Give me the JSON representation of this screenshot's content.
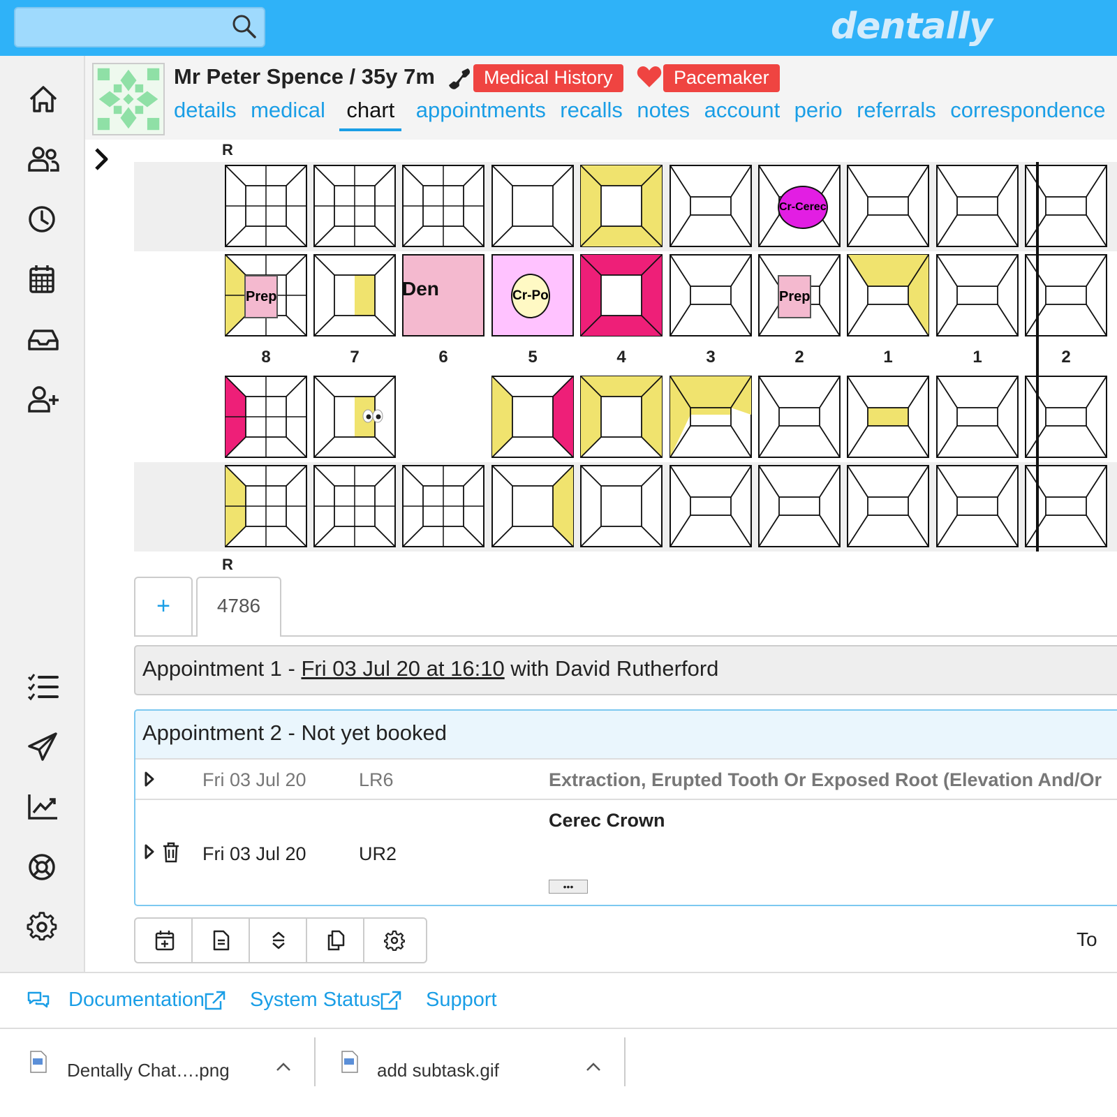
{
  "brand": "dentally",
  "search": {
    "placeholder": ""
  },
  "patient": {
    "name": "Mr Peter Spence / 35y 7m",
    "badge_medical": "Medical History",
    "badge_alert": "Pacemaker"
  },
  "tabs": [
    "details",
    "medical",
    "chart",
    "appointments",
    "recalls",
    "notes",
    "account",
    "perio",
    "referrals",
    "correspondence"
  ],
  "active_tab": "chart",
  "chart": {
    "quadrant_label_top": "R",
    "quadrant_label_bottom": "R",
    "tooth_numbers": [
      "8",
      "7",
      "6",
      "5",
      "4",
      "3",
      "2",
      "1",
      "1",
      "2"
    ],
    "annotations": {
      "upper_2_buccal": "Cr-Cerec",
      "upper_8_occlusal": "Prep",
      "upper_6": "Den",
      "upper_5": "Cr-Po",
      "upper_2_occlusal": "Prep"
    },
    "colors": {
      "filling": "#f0e36e",
      "extraction": "#ee1f78",
      "prep": "#f4b9cf",
      "crown_cerec": "#e21ee3",
      "crown_po": "#fff9c4",
      "denture_bg": "#ffc2ff"
    }
  },
  "course_tabs": {
    "add": "+",
    "course_id": "4786"
  },
  "appointment1": {
    "prefix": "Appointment 1 - ",
    "date": "Fri 03 Jul 20 at 16:10",
    "suffix": " with David Rutherford"
  },
  "appointment2": {
    "title": "Appointment 2 - Not yet booked",
    "treatments": [
      {
        "date": "Fri 03 Jul 20",
        "tooth": "LR6",
        "description": "Extraction, Erupted Tooth Or Exposed Root (Elevation And/Or"
      },
      {
        "date": "Fri 03 Jul 20",
        "tooth": "UR2",
        "description": "Cerec Crown",
        "more": "•••"
      }
    ]
  },
  "toolbar_trailing": "To",
  "footer": {
    "documentation": "Documentation",
    "system_status": "System Status",
    "support": "Support"
  },
  "downloads": [
    {
      "name": "Dentally Chat….png",
      "type": "PNG"
    },
    {
      "name": "add subtask.gif",
      "type": "GIF"
    }
  ]
}
